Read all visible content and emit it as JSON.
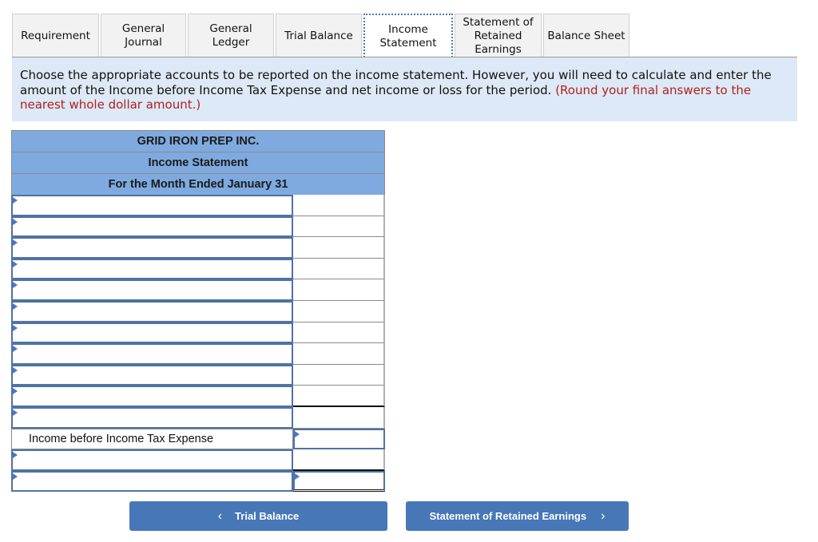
{
  "tabs": [
    {
      "label": "Requirement",
      "active": false
    },
    {
      "label": "General Journal",
      "active": false
    },
    {
      "label": "General Ledger",
      "active": false
    },
    {
      "label": "Trial Balance",
      "active": false
    },
    {
      "label": "Income Statement",
      "active": true
    },
    {
      "label": "Statement of Retained Earnings",
      "active": false
    },
    {
      "label": "Balance Sheet",
      "active": false
    }
  ],
  "instructions": {
    "text": "Choose the appropriate accounts to be reported on the income statement. However, you will need to calculate and enter the amount of the Income before Income Tax Expense and net income or loss for the period. ",
    "note": "(Round your final answers to the nearest whole dollar amount.)"
  },
  "statement": {
    "company": "GRID IRON PREP INC.",
    "title": "Income Statement",
    "period": "For the Month Ended January 31",
    "subtotal_label": "Income before Income Tax Expense",
    "account_rows_before_subtotal": 11,
    "account_rows_after_subtotal": 2,
    "account_placeholder": "",
    "amount_placeholder": ""
  },
  "nav": {
    "prev_label": "Trial Balance",
    "next_label": "Statement of Retained Earnings",
    "prev_icon": "chevron-left-icon",
    "next_icon": "chevron-right-icon"
  },
  "colors": {
    "header_blue": "#7eaadf",
    "button_blue": "#4777b6",
    "instruction_bg": "#dde9f6",
    "note_red": "#b02020"
  }
}
